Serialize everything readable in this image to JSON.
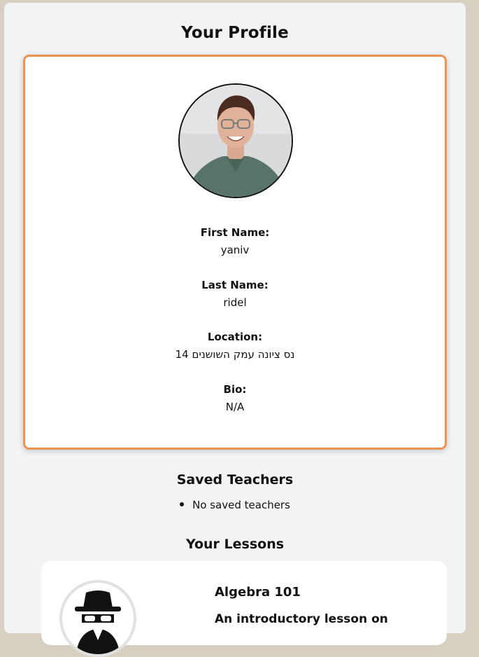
{
  "header": {
    "title": "Your Profile"
  },
  "profile": {
    "avatar_icon": "user-photo",
    "first_name": {
      "label": "First Name:",
      "value": "yaniv"
    },
    "last_name": {
      "label": "Last Name:",
      "value": "ridel"
    },
    "location": {
      "label": "Location:",
      "value": "נס ציונה עמק השושנים 14"
    },
    "bio": {
      "label": "Bio:",
      "value": "N/A"
    }
  },
  "saved_teachers": {
    "title": "Saved Teachers",
    "items": [
      "No saved teachers"
    ]
  },
  "lessons": {
    "title": "Your Lessons",
    "items": [
      {
        "icon": "spy-icon",
        "title": "Algebra 101",
        "description": "An introductory lesson on"
      }
    ]
  },
  "colors": {
    "accent": "#f0924f",
    "page_bg": "#f2f3f5",
    "outer_bg": "#d8cfc3"
  }
}
